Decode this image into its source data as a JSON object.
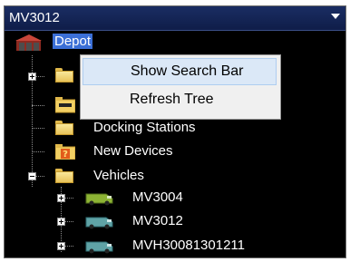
{
  "window": {
    "title": "MV3012"
  },
  "tree": {
    "root": {
      "label": "Depot",
      "icon": "depot-icon"
    },
    "items": [
      {
        "label": "Docking Stations",
        "icon": "folder-icon"
      },
      {
        "label": "New Devices",
        "icon": "folder-question-icon"
      },
      {
        "label": "Vehicles",
        "icon": "folder-icon"
      }
    ],
    "vehicles": [
      {
        "label": "MV3004",
        "icon": "van-icon-green"
      },
      {
        "label": "MV3012",
        "icon": "van-icon-teal"
      },
      {
        "label": "MVH30081301211",
        "icon": "van-icon-teal"
      }
    ]
  },
  "context_menu": {
    "items": [
      {
        "label": "Show Search Bar"
      },
      {
        "label": "Refresh Tree"
      }
    ]
  },
  "colors": {
    "title_bg": "#1a2d63",
    "panel_bg": "#000000",
    "selection": "#3b6fd6",
    "menu_bg": "#f0f0f0",
    "menu_hover": "#dbe8f7"
  }
}
